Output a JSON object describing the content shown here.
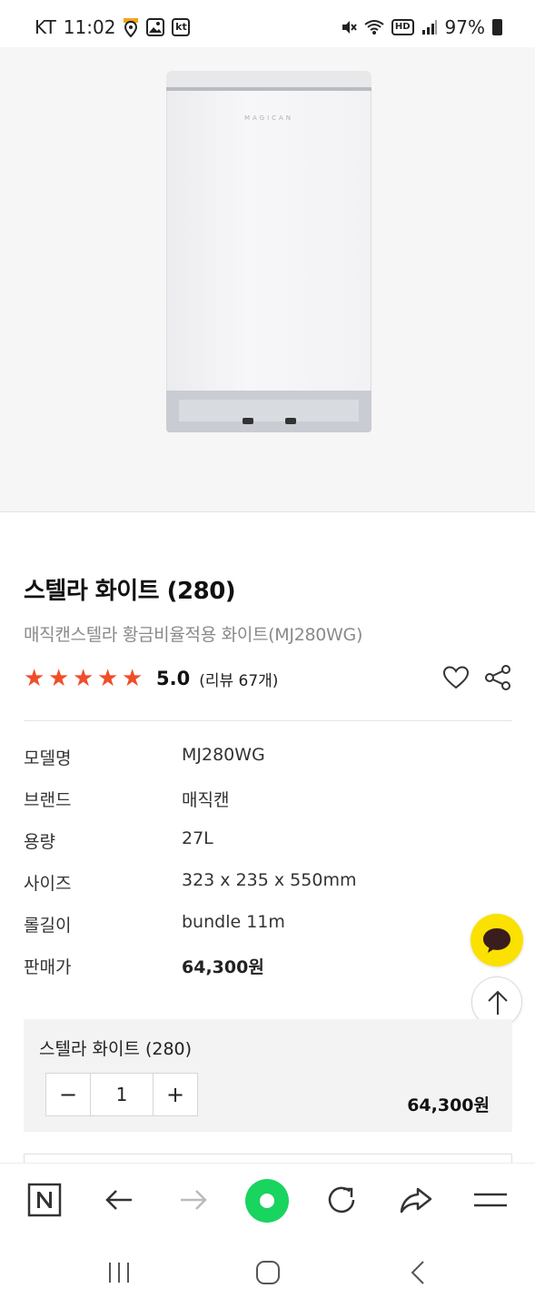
{
  "status_bar": {
    "carrier": "KT",
    "time": "11:02",
    "kt_badge": "kt",
    "hd_badge": "HD",
    "battery": "97%"
  },
  "product": {
    "image_logo": "MAGICAN",
    "title": "스텔라 화이트 (280)",
    "subtitle": "매직캔스텔라 황금비율적용 화이트(MJ280WG)",
    "rating": {
      "stars": 5,
      "score": "5.0",
      "reviews": "(리뷰 67개)"
    }
  },
  "specs": [
    {
      "label": "모델명",
      "value": "MJ280WG"
    },
    {
      "label": "브랜드",
      "value": "매직캔"
    },
    {
      "label": "용량",
      "value": "27L"
    },
    {
      "label": "사이즈",
      "value": "323 x 235 x 550mm"
    },
    {
      "label": "롤길이",
      "value": "bundle 11m"
    },
    {
      "label": "판매가",
      "value": "64,300원"
    }
  ],
  "option": {
    "name": "스텔라 화이트 (280)",
    "minus": "−",
    "quantity": "1",
    "plus": "+",
    "price": "64,300원"
  },
  "toolbar": {
    "icons": [
      "naver-n-icon",
      "back-arrow-icon",
      "forward-arrow-icon",
      "home-icon",
      "refresh-icon",
      "share-forward-icon",
      "menu-icon"
    ],
    "home_color": "#19d45f"
  },
  "colors": {
    "star": "#f04e2a",
    "kakao": "#fae100"
  }
}
